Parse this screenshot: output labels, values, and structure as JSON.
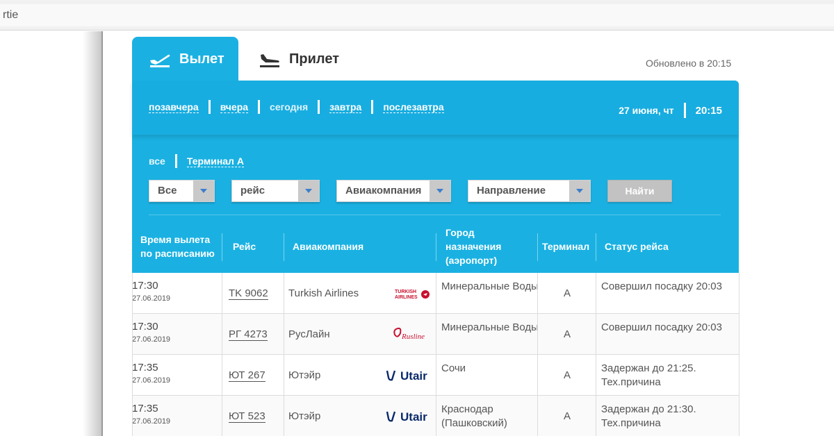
{
  "browser": {
    "url_fragment": "rtie"
  },
  "tabs": {
    "departure": "Вылет",
    "arrival": "Прилет"
  },
  "updated_text": "Обновлено в 20:15",
  "days": [
    "позавчера",
    "вчера",
    "сегодня",
    "завтра",
    "послезавтра"
  ],
  "date_display": {
    "date": "27 июня, чт",
    "time": "20:15"
  },
  "terminals": {
    "all": "все",
    "terminal_a": "Терминал А"
  },
  "filters": {
    "type": "Все",
    "flight": "рейс",
    "airline": "Авиакомпания",
    "direction": "Направление",
    "find_button": "Найти"
  },
  "columns": {
    "time": "Время вылета по расписанию",
    "flight": "Рейс",
    "airline": "Авиакомпания",
    "city": "Город назначения (аэропорт)",
    "terminal": "Терминал",
    "status": "Статус рейса"
  },
  "rows": [
    {
      "time": "17:30",
      "date": "27.06.2019",
      "flight": "TK 9062",
      "airline": "Turkish Airlines",
      "logo": "TURKISH AIRLINES",
      "city": "Минеральные Воды",
      "terminal": "A",
      "status": "Совершил посадку 20:03"
    },
    {
      "time": "17:30",
      "date": "27.06.2019",
      "flight": "РГ 4273",
      "airline": "РусЛайн",
      "logo": "Rusline",
      "city": "Минеральные Воды",
      "terminal": "A",
      "status": "Совершил посадку 20:03"
    },
    {
      "time": "17:35",
      "date": "27.06.2019",
      "flight": "ЮТ 267",
      "airline": "Ютэйр",
      "logo": "Utair",
      "city": "Сочи",
      "terminal": "A",
      "status": "Задержан до 21:25. Тех.причина"
    },
    {
      "time": "17:35",
      "date": "27.06.2019",
      "flight": "ЮТ 523",
      "airline": "Ютэйр",
      "logo": "Utair",
      "city": "Краснодар (Пашковский)",
      "terminal": "A",
      "status": "Задержан до 21:30. Тех.причина"
    }
  ],
  "colors": {
    "accent": "#1ab1e2",
    "text": "#555555"
  }
}
